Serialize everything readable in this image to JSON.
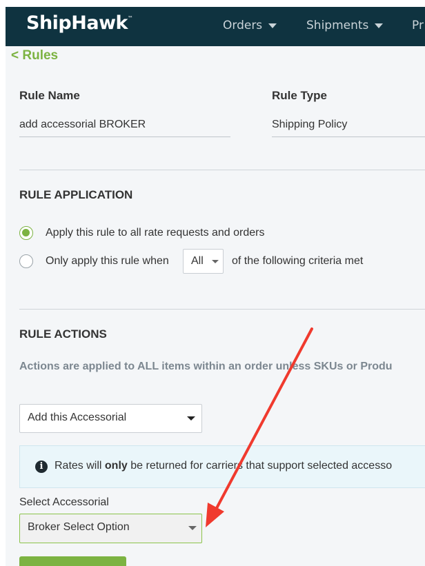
{
  "navbar": {
    "logo": "ShipHawk",
    "trademark": "™",
    "items": [
      {
        "label": "Orders"
      },
      {
        "label": "Shipments"
      },
      {
        "label": "Pr"
      }
    ]
  },
  "back_link": "< Rules",
  "rule_name": {
    "label": "Rule Name",
    "value": "add accessorial BROKER"
  },
  "rule_type": {
    "label": "Rule Type",
    "value": "Shipping Policy"
  },
  "rule_application": {
    "title": "RULE APPLICATION",
    "option_all": "Apply this rule to all rate requests and orders",
    "option_conditional": "Only apply this rule when",
    "criteria_select": "All",
    "criteria_suffix": "of the following criteria met"
  },
  "rule_actions": {
    "title": "RULE ACTIONS",
    "description": "Actions are applied to ALL items within an order unless SKUs or Produ",
    "action_select": "Add this Accessorial",
    "info": {
      "prefix": "Rates will ",
      "emphasis": "only",
      "suffix": " be returned for carriers that support selected accesso"
    },
    "accessorial_label": "Select Accessorial",
    "accessorial_select": "Broker Select Option"
  },
  "colors": {
    "navbar": "#0f3340",
    "accent": "#7cb342",
    "arrow": "#f03a2e"
  },
  "icons": {
    "info": "info-circle-icon",
    "dropdown": "caret-down-icon"
  }
}
